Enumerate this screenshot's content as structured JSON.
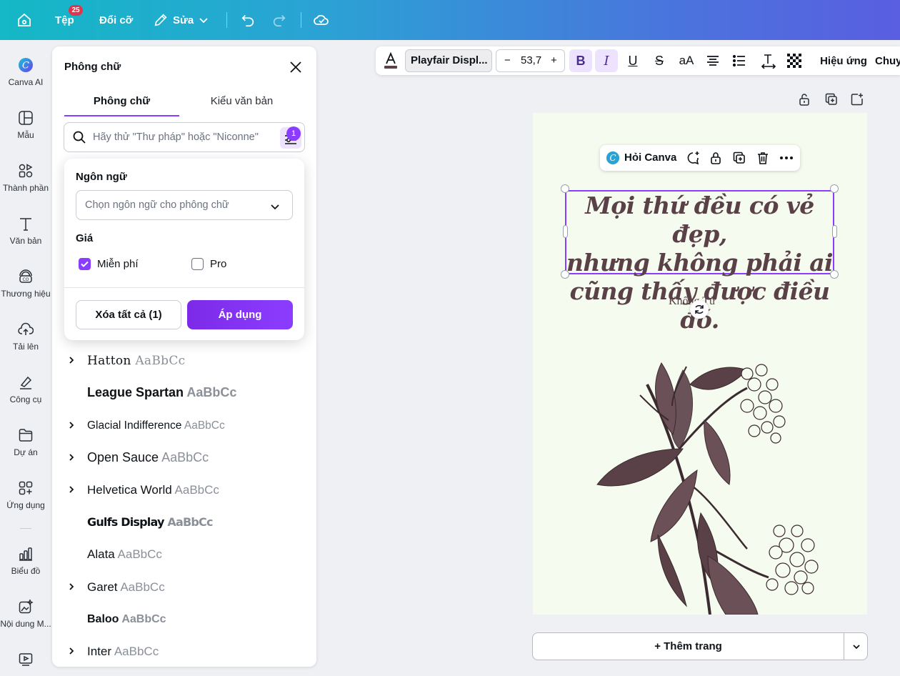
{
  "topbar": {
    "file_label": "Tệp",
    "file_badge": "25",
    "resize_label": "Đổi cỡ",
    "edit_label": "Sửa"
  },
  "sidebar": {
    "items": [
      {
        "label": "Canva AI",
        "icon": "canva-ai-icon"
      },
      {
        "label": "Mẫu",
        "icon": "template-icon"
      },
      {
        "label": "Thành phần",
        "icon": "elements-icon"
      },
      {
        "label": "Văn bản",
        "icon": "text-icon"
      },
      {
        "label": "Thương hiệu",
        "icon": "brand-icon"
      },
      {
        "label": "Tải lên",
        "icon": "upload-icon"
      },
      {
        "label": "Công cụ",
        "icon": "tools-icon"
      },
      {
        "label": "Dự án",
        "icon": "folder-icon"
      },
      {
        "label": "Ứng dụng",
        "icon": "apps-icon"
      },
      {
        "label": "Biểu đồ",
        "icon": "chart-icon"
      },
      {
        "label": "Nội dung M...",
        "icon": "magic-media-icon"
      }
    ]
  },
  "panel": {
    "title": "Phông chữ",
    "tabs": [
      {
        "label": "Phông chữ",
        "active": true
      },
      {
        "label": "Kiểu văn bản",
        "active": false
      }
    ],
    "search_placeholder": "Hãy thử \"Thư pháp\" hoặc \"Niconne\"",
    "filter_count": "1"
  },
  "filter": {
    "language_heading": "Ngôn ngữ",
    "language_placeholder": "Chọn ngôn ngữ cho phông chữ",
    "price_heading": "Giá",
    "free_label": "Miễn phí",
    "free_checked": true,
    "pro_label": "Pro",
    "pro_checked": false,
    "clear_label": "Xóa tất cả (1)",
    "apply_label": "Áp dụng"
  },
  "fonts": [
    {
      "name": "Hatton",
      "sample": "AaBbCc",
      "expandable": true
    },
    {
      "name": "League Spartan",
      "sample": "AaBbCc",
      "expandable": false
    },
    {
      "name": "Glacial Indifference",
      "sample": "AaBbCc",
      "expandable": true
    },
    {
      "name": "Open Sauce",
      "sample": "AaBbCc",
      "expandable": true
    },
    {
      "name": "Helvetica World",
      "sample": "AaBbCc",
      "expandable": true
    },
    {
      "name": "Gulfs Display",
      "sample": "AaBbCc",
      "expandable": false
    },
    {
      "name": "Alata",
      "sample": "AaBbCc",
      "expandable": false
    },
    {
      "name": "Garet",
      "sample": "AaBbCc",
      "expandable": true
    },
    {
      "name": "Baloo",
      "sample": "AaBbCc",
      "expandable": false
    },
    {
      "name": "Inter",
      "sample": "AaBbCc",
      "expandable": true
    }
  ],
  "toolbar": {
    "font_name": "Playfair Displ...",
    "font_size": "53,7",
    "minus": "−",
    "plus": "+",
    "bold": "B",
    "italic": "I",
    "underline": "U",
    "strike": "S",
    "case": "aA",
    "effects_label": "Hiệu ứng",
    "animate_label": "Chuy"
  },
  "canvas": {
    "ask_label": "Hỏi Canva",
    "quote_lines": [
      "Mọi thứ đều có vẻ đẹp,",
      "nhưng không phải ai",
      "cũng thấy được điều đó."
    ],
    "author": "Khổng Tử",
    "background_color": "#f5fbee",
    "text_color": "#5a4148"
  },
  "footer": {
    "add_page_label": "+ Thêm trang"
  },
  "colors": {
    "accent": "#8b3dff",
    "topbar_start": "#14b8c6",
    "topbar_end": "#5a5ee0"
  }
}
